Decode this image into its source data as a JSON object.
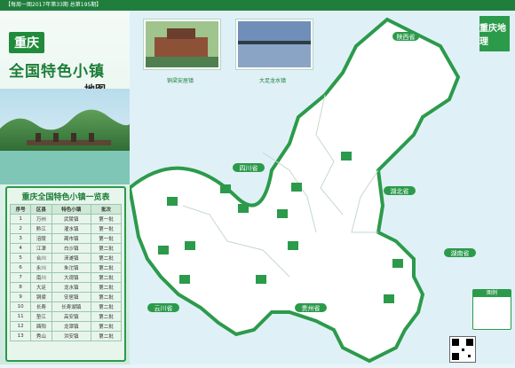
{
  "header": {
    "text": "【每周一图2017年第33期 总第195期】"
  },
  "title": {
    "chongqing": "重庆",
    "main": "全国特色小镇",
    "sub": "地图"
  },
  "photos": [
    {
      "caption": "铜梁安居镇"
    },
    {
      "caption": "大足龙水镇"
    }
  ],
  "province_labels": [
    {
      "label": "陕西省"
    },
    {
      "label": "四川省"
    },
    {
      "label": "湖北省"
    },
    {
      "label": "湖南省"
    },
    {
      "label": "贵州省"
    },
    {
      "label": "云川省"
    }
  ],
  "table": {
    "title": "重庆全国特色小镇一览表",
    "headers": [
      "序号",
      "区县",
      "特色小镇",
      "批次"
    ],
    "rows": [
      [
        "1",
        "万州",
        "武陵镇",
        "第一批"
      ],
      [
        "2",
        "黔江",
        "濯水镇",
        "第一批"
      ],
      [
        "3",
        "涪陵",
        "蔺市镇",
        "第一批"
      ],
      [
        "4",
        "江津",
        "白沙镇",
        "第二批"
      ],
      [
        "5",
        "合川",
        "涞滩镇",
        "第二批"
      ],
      [
        "6",
        "永川",
        "朱沱镇",
        "第二批"
      ],
      [
        "7",
        "南川",
        "大观镇",
        "第二批"
      ],
      [
        "8",
        "大足",
        "龙水镇",
        "第二批"
      ],
      [
        "9",
        "铜梁",
        "安居镇",
        "第二批"
      ],
      [
        "10",
        "长寿",
        "长寿湖镇",
        "第二批"
      ],
      [
        "11",
        "垫江",
        "高安镇",
        "第二批"
      ],
      [
        "12",
        "酉阳",
        "龙潭镇",
        "第二批"
      ],
      [
        "13",
        "秀山",
        "洪安镇",
        "第二批"
      ]
    ]
  },
  "corner_logo": {
    "text": "重庆地理"
  },
  "legend": {
    "title": "图例"
  },
  "colors": {
    "green": "#1f8b3a",
    "light_green": "#e8f5ed",
    "water": "#dff1f7"
  }
}
